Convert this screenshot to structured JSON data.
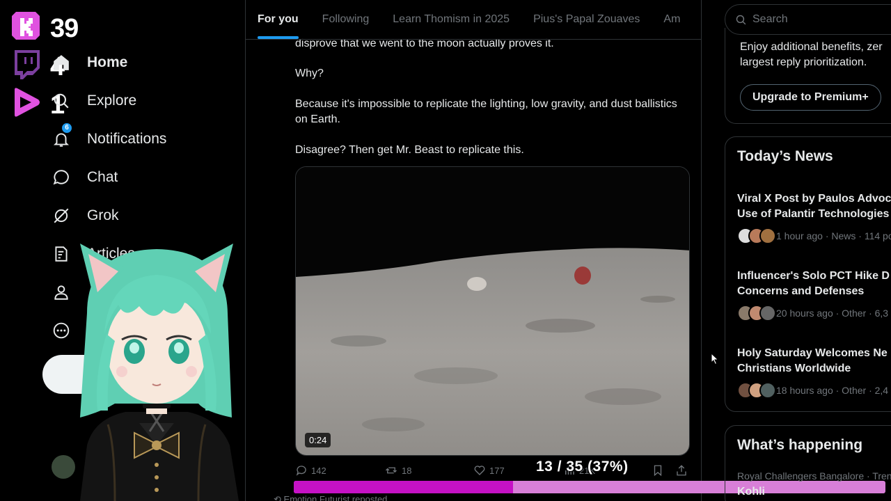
{
  "stream": {
    "badges": [
      {
        "icon": "kick-icon",
        "color": "#e052e0",
        "count": "39"
      },
      {
        "icon": "twitch-icon",
        "color": "#7b3f9e",
        "count": "4"
      },
      {
        "icon": "youtube-play-icon",
        "color": "#e052e0",
        "count": "1"
      }
    ]
  },
  "nav": {
    "items": [
      {
        "icon": "home-icon",
        "label": "Home"
      },
      {
        "icon": "explore-icon",
        "label": "Explore"
      },
      {
        "icon": "bell-icon",
        "label": "Notifications",
        "badge": "6"
      },
      {
        "icon": "chat-icon",
        "label": "Chat"
      },
      {
        "icon": "grok-icon",
        "label": "Grok"
      },
      {
        "icon": "articles-icon",
        "label": "Articles"
      }
    ]
  },
  "tabs": [
    {
      "label": "For you",
      "active": true
    },
    {
      "label": "Following"
    },
    {
      "label": "Learn Thomism in 2025"
    },
    {
      "label": "Pius's Papal Zouaves"
    },
    {
      "label": "Am"
    }
  ],
  "post": {
    "paragraphs": [
      "disprove that we went to the moon actually proves it.",
      "Why?",
      "Because it's impossible to replicate the lighting, low gravity, and dust ballistics on Earth.",
      "Disagree? Then get Mr. Beast to replicate this."
    ],
    "duration": "0:24",
    "replies": "142",
    "reposts": "18",
    "likes": "177",
    "views": "21K",
    "retweeted_by": "Emotion Futurist",
    "retweeted_suffix": "reposted"
  },
  "progress": {
    "label": "13 / 35 (37%)",
    "fraction": 0.37,
    "fill_color": "#c512c5",
    "track_color": "#d87fd8"
  },
  "search": {
    "placeholder": "Search"
  },
  "premium": {
    "line1": "Enjoy additional benefits, zer",
    "line2": "largest reply prioritization.",
    "button": "Upgrade to Premium+"
  },
  "news": {
    "title": "Today’s News",
    "items": [
      {
        "title": "Viral X Post by Paulos Advoc\nUse of Palantir Technologies",
        "meta": "1 hour ago · News · 114 po"
      },
      {
        "title": "Influencer's Solo PCT Hike D\nConcerns and Defenses",
        "meta": "20 hours ago · Other · 6,3"
      },
      {
        "title": "Holy Saturday Welcomes Ne\nChristians Worldwide",
        "meta": "18 hours ago · Other · 2,4"
      }
    ]
  },
  "happening": {
    "title": "What’s happening",
    "trend_category": "Royal Challengers Bangalore · Tren",
    "trend_name": "Kohli"
  },
  "colors": {
    "accent": "#1d9bf0",
    "border": "#2f3336",
    "muted": "#71767b"
  }
}
